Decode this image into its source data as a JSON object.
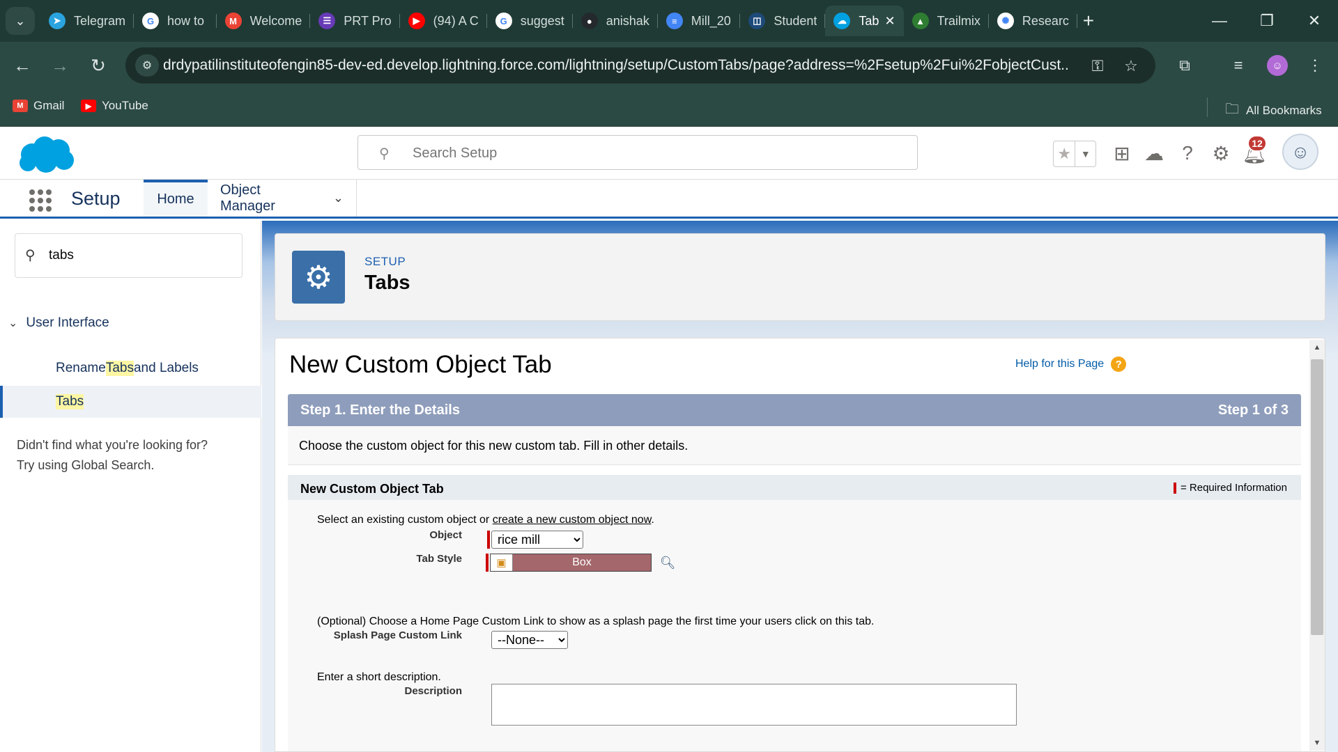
{
  "browser": {
    "tabs": [
      {
        "title": "Telegram",
        "icon": "telegram-icon",
        "color": "#2aa3df",
        "glyph": "➤"
      },
      {
        "title": "how to",
        "icon": "google-icon",
        "color": "#ffffff",
        "glyph": "G"
      },
      {
        "title": "Welcome",
        "icon": "gmail-icon",
        "color": "#ea4335",
        "glyph": "M"
      },
      {
        "title": "PRT Pro",
        "icon": "forms-icon",
        "color": "#673ab7",
        "glyph": "☰"
      },
      {
        "title": "(94) A C",
        "icon": "youtube-icon",
        "color": "#ff0000",
        "glyph": "▶"
      },
      {
        "title": "suggest",
        "icon": "google-icon",
        "color": "#ffffff",
        "glyph": "G"
      },
      {
        "title": "anishak",
        "icon": "github-icon",
        "color": "#24292e",
        "glyph": "●"
      },
      {
        "title": "Mill_20",
        "icon": "docs-icon",
        "color": "#4285f4",
        "glyph": "≡"
      },
      {
        "title": "Student",
        "icon": "app-icon",
        "color": "#1e4a7a",
        "glyph": "◫"
      }
    ],
    "active_tab": {
      "title": "Tab",
      "icon": "salesforce-icon",
      "color": "#00a1e0"
    },
    "tabs_after": [
      {
        "title": "Trailmix",
        "icon": "trailhead-icon",
        "color": "#2e7d32",
        "glyph": "▲"
      },
      {
        "title": "Researc",
        "icon": "openai-icon",
        "color": "#ffffff",
        "glyph": "✺"
      }
    ],
    "url": "drdypatilinstituteofengin85-dev-ed.develop.lightning.force.com/lightning/setup/CustomTabs/page?address=%2Fsetup%2Fui%2FobjectCust...",
    "bookmarks": [
      {
        "label": "Gmail",
        "icon": "gmail-icon",
        "color": "#ea4335",
        "glyph": "M"
      },
      {
        "label": "YouTube",
        "icon": "youtube-icon",
        "color": "#ff0000",
        "glyph": "▶"
      }
    ],
    "all_bookmarks": "All Bookmarks"
  },
  "sf": {
    "search_placeholder": "Search Setup",
    "notifications_count": "12",
    "app_name": "Setup",
    "nav_home": "Home",
    "nav_object_manager": "Object Manager"
  },
  "sidebar": {
    "quickfind_value": "tabs",
    "section": "User Interface",
    "items": [
      {
        "pre": "Rename ",
        "hl": "Tabs",
        "post": " and Labels"
      },
      {
        "pre": "",
        "hl": "Tabs",
        "post": ""
      }
    ],
    "not_found_line1": "Didn't find what you're looking for?",
    "not_found_line2": "Try using Global Search."
  },
  "page": {
    "breadcrumb": "SETUP",
    "title": "Tabs",
    "content_title": "New Custom Object Tab",
    "help_link": "Help for this Page",
    "step_title": "Step 1. Enter the Details",
    "step_count": "Step 1 of 3",
    "step_description": "Choose the custom object for this new custom tab. Fill in other details.",
    "section_title": "New Custom Object Tab",
    "required_info": "= Required Information",
    "select_text_pre": "Select an existing custom object or ",
    "select_link": "create a new custom object now",
    "select_text_post": ".",
    "object_label": "Object",
    "object_value": "rice mill",
    "tab_style_label": "Tab Style",
    "tab_style_value": "Box",
    "splash_text": "(Optional) Choose a Home Page Custom Link to show as a splash page the first time your users click on this tab.",
    "splash_label": "Splash Page Custom Link",
    "splash_value": "--None--",
    "desc_text": "Enter a short description.",
    "desc_label": "Description"
  },
  "colors": {
    "salesforce_blue": "#1b5fb0",
    "step_bar": "#8e9dbb",
    "tab_style_swatch": "#a4676c",
    "required_red": "#cc0000"
  }
}
